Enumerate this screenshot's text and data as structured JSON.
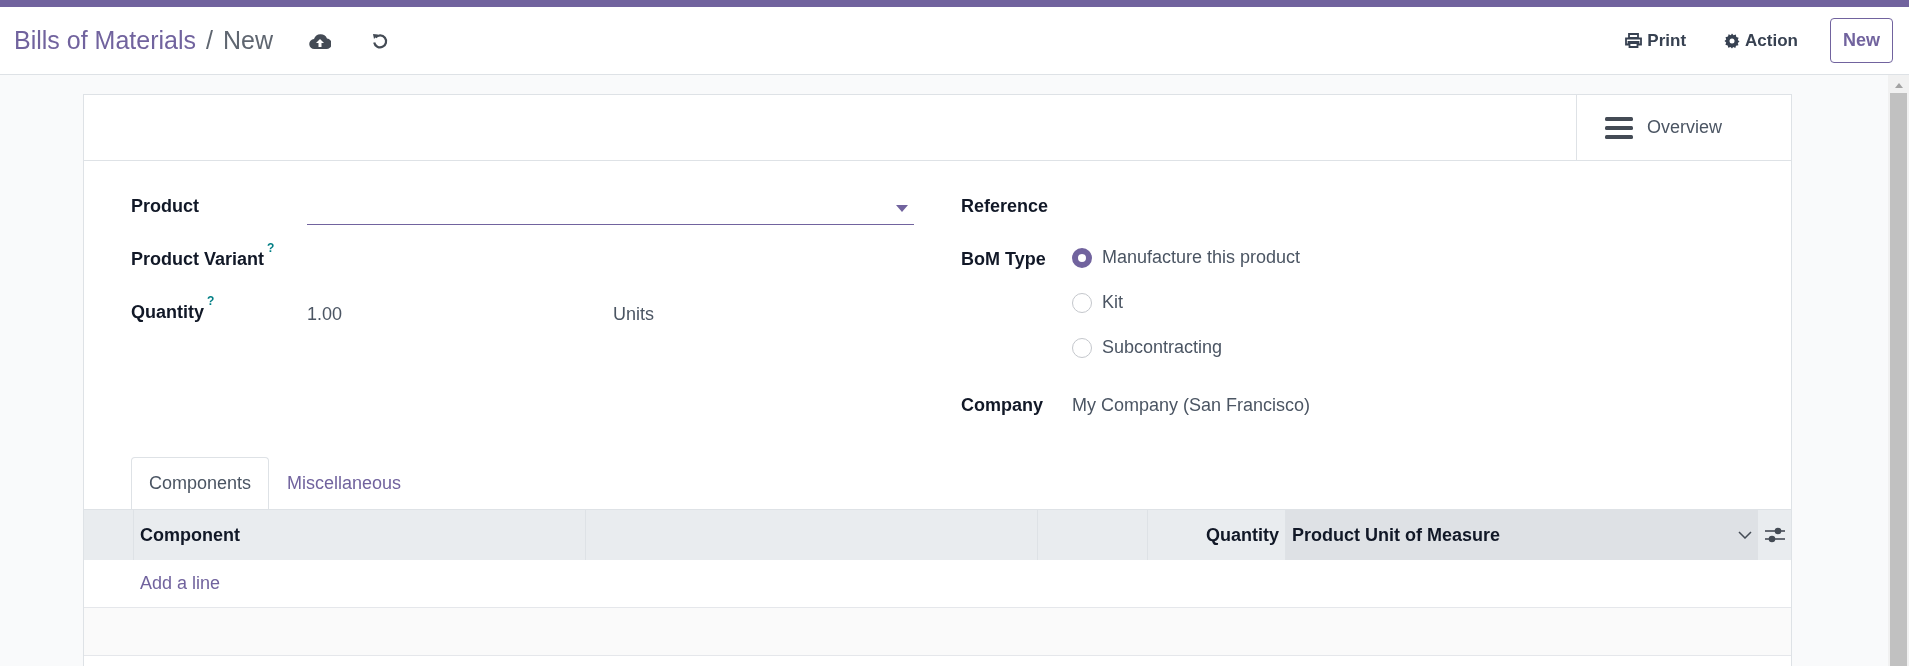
{
  "breadcrumb": {
    "parent": "Bills of Materials",
    "separator": "/",
    "current": "New"
  },
  "header_actions": [
    {
      "label": "Print",
      "kind": "print"
    },
    {
      "label": "Action",
      "kind": "gear"
    }
  ],
  "new_button": "New",
  "overview_button": "Overview",
  "left_fields": [
    {
      "label": "Product",
      "kind": "select",
      "help": false
    },
    {
      "label": "Product Variant",
      "kind": "empty",
      "help": true
    },
    {
      "label": "Quantity",
      "kind": "quantity",
      "help": true,
      "value": "1.00",
      "unit": "Units"
    }
  ],
  "help_mark": "?",
  "reference": {
    "label": "Reference"
  },
  "bom_type": {
    "label": "BoM Type",
    "options": [
      {
        "label": "Manufacture this product",
        "selected": true
      },
      {
        "label": "Kit",
        "selected": false
      },
      {
        "label": "Subcontracting",
        "selected": false
      }
    ]
  },
  "company": {
    "label": "Company",
    "value": "My Company (San Francisco)"
  },
  "tabs": [
    {
      "label": "Components",
      "selected": true
    },
    {
      "label": "Miscellaneous",
      "selected": false
    }
  ],
  "table": {
    "columns": [
      "Component",
      null,
      null,
      "Quantity",
      "Product Unit of Measure"
    ],
    "add_line": "Add a line"
  }
}
